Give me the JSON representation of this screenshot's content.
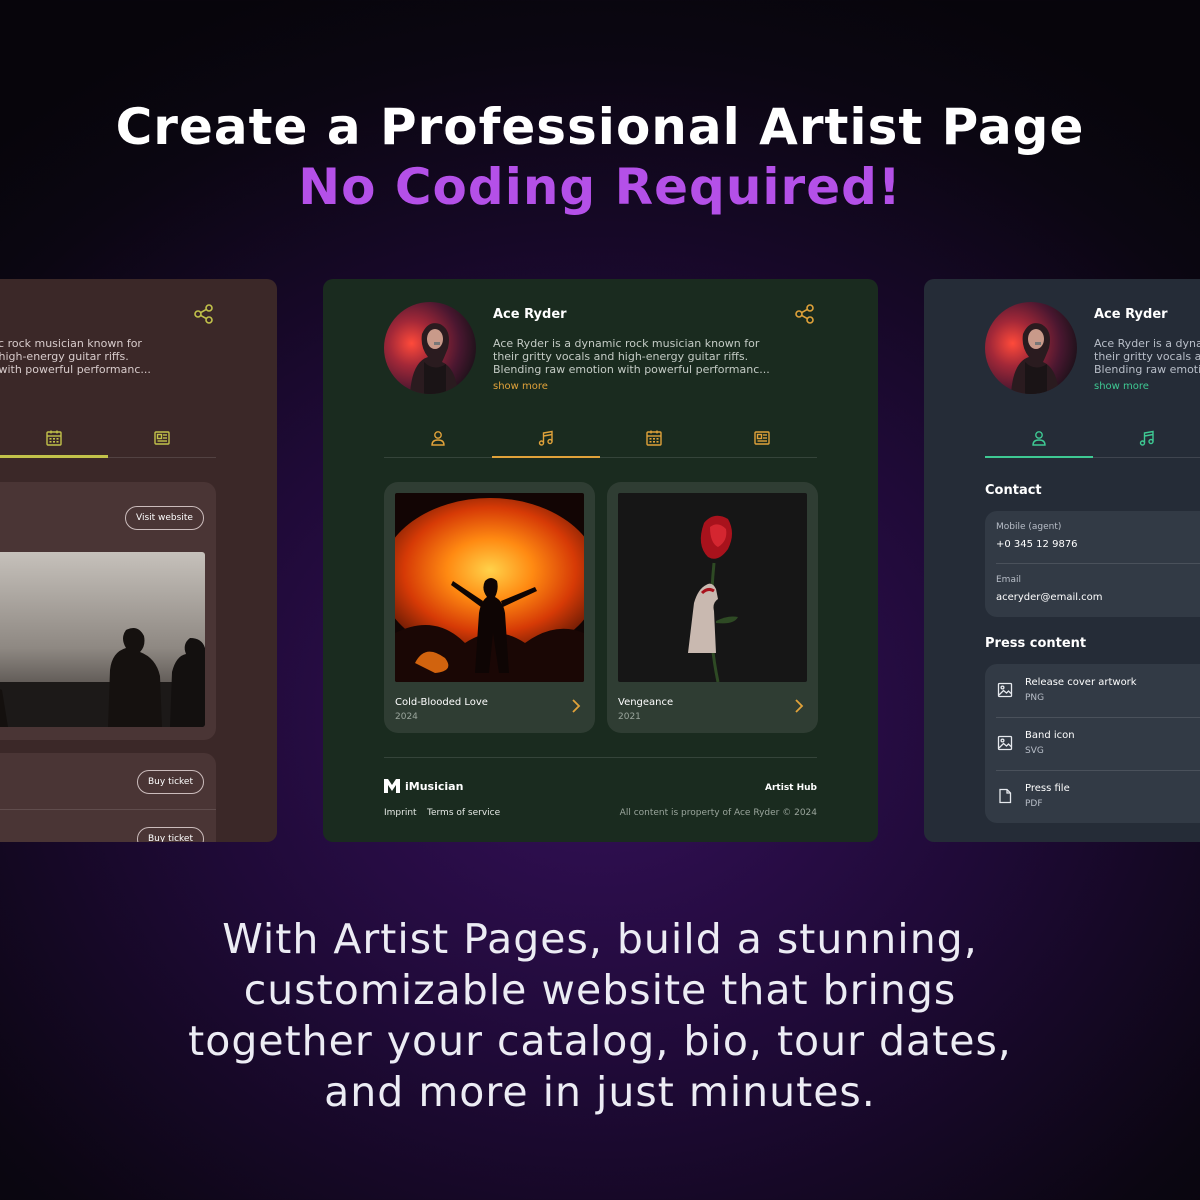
{
  "headline": {
    "line1": "Create a Professional Artist Page",
    "line2": "No Coding Required!"
  },
  "subtitle": "With Artist Pages, build a stunning, customizable website that brings together your catalog, bio, tour dates, and more in just minutes.",
  "colors": {
    "accent_purple": "#b450e8",
    "center_accent": "#e0a23a",
    "left_accent": "#c2c24a",
    "right_accent": "#3ec993"
  },
  "left_card": {
    "bio_lines": "nic rock musician known for\nd high-energy guitar riffs.\nn with powerful performanc...",
    "visit_website": "Visit website",
    "buy_ticket_1": "Buy ticket",
    "buy_ticket_2": "Buy ticket"
  },
  "center_card": {
    "artist_name": "Ace Ryder",
    "bio": "Ace Ryder is a dynamic rock musician known for\ntheir gritty vocals and high-energy guitar riffs.\nBlending raw emotion with powerful performanc...",
    "show_more": "show more",
    "tabs": [
      "person-icon",
      "music-note-icon",
      "calendar-icon",
      "newspaper-icon"
    ],
    "releases": [
      {
        "title": "Cold-Blooded Love",
        "year": "2024"
      },
      {
        "title": "Vengeance",
        "year": "2021"
      }
    ],
    "footer": {
      "logo_text": "iMusician",
      "hub": "Artist Hub",
      "imprint": "Imprint",
      "terms": "Terms of service",
      "copyright": "All content is property of Ace Ryder  ©  2024"
    }
  },
  "right_card": {
    "artist_name": "Ace Ryder",
    "bio_lines": "Ace Ryder is a dyna\ntheir gritty vocals an\nBlending raw emotio",
    "show_more": "show more",
    "contact_heading": "Contact",
    "mobile_label": "Mobile (agent)",
    "mobile_value": "+0 345 12 9876",
    "email_label": "Email",
    "email_value": "aceryder@email.com",
    "press_heading": "Press content",
    "press_items": [
      {
        "title": "Release cover artwork",
        "type": "PNG"
      },
      {
        "title": "Band icon",
        "type": "SVG"
      },
      {
        "title": "Press file",
        "type": "PDF"
      }
    ]
  }
}
